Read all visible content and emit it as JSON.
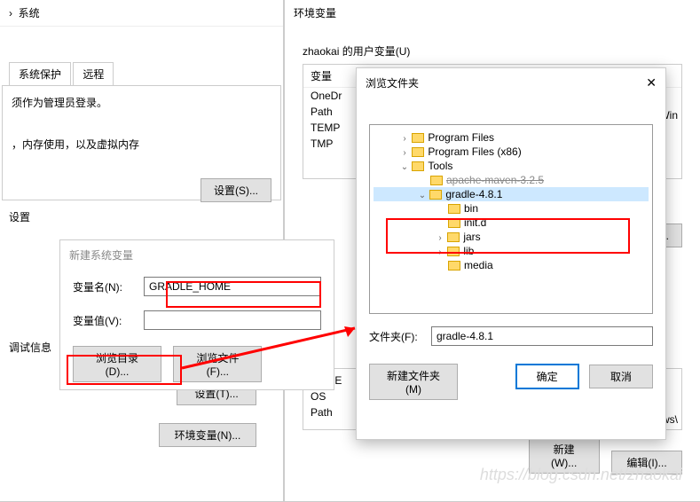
{
  "sysprops": {
    "breadcrumb_tail": "系统",
    "tabs": [
      "系统保护",
      "远程"
    ],
    "admin_note": "须作为管理员登录。",
    "memory_note": "，内存使用，以及虚拟内存",
    "settings_s_btn": "设置(S)...",
    "settings_label": "设置",
    "debug_info": "调试信息",
    "settings_t_btn": "设置(T)...",
    "envvar_btn": "环境变量(N)..."
  },
  "envdlg": {
    "title_fragment": "环境变量",
    "user_vars_header": "zhaokai 的用户变量(U)",
    "col_var": "变量",
    "rows": [
      "OneDr",
      "Path",
      "TEMP",
      "TMP"
    ],
    "right_cut": "ft\\Win",
    "edit_btn": "编辑(E)...",
    "sys_rows": [
      "NUME",
      "OS",
      "Path"
    ],
    "sys_right": "dows\\",
    "new_btn": "新建(W)...",
    "edit2_btn": "编辑(I)..."
  },
  "newvar": {
    "title": "新建系统变量",
    "name_label": "变量名(N):",
    "name_value": "GRADLE_HOME",
    "value_label": "变量值(V):",
    "value_value": "",
    "browse_dir": "浏览目录(D)...",
    "browse_file": "浏览文件(F)..."
  },
  "browse": {
    "title": "浏览文件夹",
    "tree": {
      "pf": "Program Files",
      "pf86": "Program Files (x86)",
      "tools": "Tools",
      "maven": "apache-maven-3.2.5",
      "gradle": "gradle-4.8.1",
      "bin": "bin",
      "initd": "init.d",
      "jars": "jars",
      "lib": "lib",
      "media": "media"
    },
    "folder_label": "文件夹(F):",
    "folder_value": "gradle-4.8.1",
    "newfolder_btn": "新建文件夹(M)",
    "ok_btn": "确定",
    "cancel_btn": "取消"
  },
  "watermark": "https://blog.csdn.net/zhaokai"
}
